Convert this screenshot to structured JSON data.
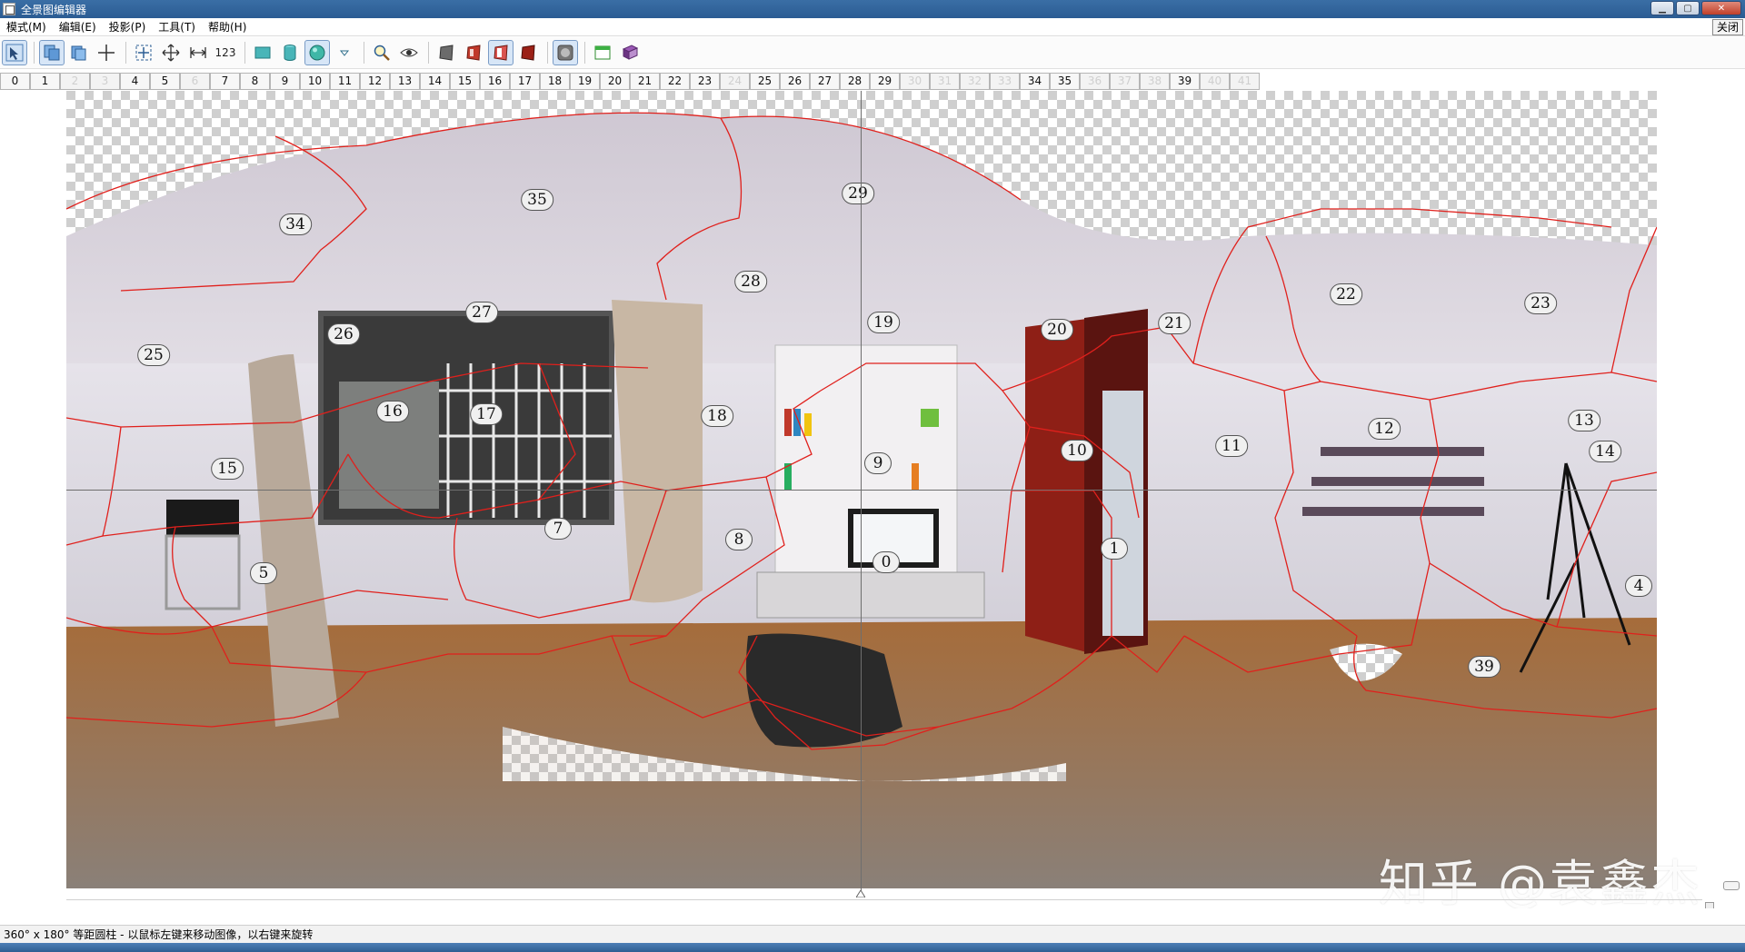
{
  "window": {
    "title": "全景图编辑器"
  },
  "menu": {
    "items": [
      "模式(M)",
      "编辑(E)",
      "投影(P)",
      "工具(T)",
      "帮助(H)"
    ],
    "close_panel": "关闭"
  },
  "toolbar": {
    "numbering_label": "123",
    "tools": [
      "select-tool-icon",
      "pages-icon",
      "pages-stack-icon",
      "crosshair-icon",
      "fit-icon",
      "move-icon",
      "straighten-icon",
      "rectilinear-icon",
      "cylinder-icon",
      "sphere-icon",
      "dropdown-icon",
      "zoom-icon",
      "preview-eye-icon",
      "layer-dark-icon",
      "layer-red-icon",
      "layer-red-selected-icon",
      "layer-red-dark-icon",
      "badge-3-icon",
      "window-green-icon",
      "book-icon"
    ],
    "badge_value": "3"
  },
  "image_tabs": [
    {
      "label": "0",
      "enabled": true
    },
    {
      "label": "1",
      "enabled": true
    },
    {
      "label": "2",
      "enabled": false
    },
    {
      "label": "3",
      "enabled": false
    },
    {
      "label": "4",
      "enabled": true
    },
    {
      "label": "5",
      "enabled": true
    },
    {
      "label": "6",
      "enabled": false
    },
    {
      "label": "7",
      "enabled": true
    },
    {
      "label": "8",
      "enabled": true
    },
    {
      "label": "9",
      "enabled": true
    },
    {
      "label": "10",
      "enabled": true
    },
    {
      "label": "11",
      "enabled": true
    },
    {
      "label": "12",
      "enabled": true
    },
    {
      "label": "13",
      "enabled": true
    },
    {
      "label": "14",
      "enabled": true
    },
    {
      "label": "15",
      "enabled": true
    },
    {
      "label": "16",
      "enabled": true
    },
    {
      "label": "17",
      "enabled": true
    },
    {
      "label": "18",
      "enabled": true
    },
    {
      "label": "19",
      "enabled": true
    },
    {
      "label": "20",
      "enabled": true
    },
    {
      "label": "21",
      "enabled": true
    },
    {
      "label": "22",
      "enabled": true
    },
    {
      "label": "23",
      "enabled": true
    },
    {
      "label": "24",
      "enabled": false
    },
    {
      "label": "25",
      "enabled": true
    },
    {
      "label": "26",
      "enabled": true
    },
    {
      "label": "27",
      "enabled": true
    },
    {
      "label": "28",
      "enabled": true
    },
    {
      "label": "29",
      "enabled": true
    },
    {
      "label": "30",
      "enabled": false
    },
    {
      "label": "31",
      "enabled": false
    },
    {
      "label": "32",
      "enabled": false
    },
    {
      "label": "33",
      "enabled": false
    },
    {
      "label": "34",
      "enabled": true
    },
    {
      "label": "35",
      "enabled": true
    },
    {
      "label": "36",
      "enabled": false
    },
    {
      "label": "37",
      "enabled": false
    },
    {
      "label": "38",
      "enabled": false
    },
    {
      "label": "39",
      "enabled": true
    },
    {
      "label": "40",
      "enabled": false
    },
    {
      "label": "41",
      "enabled": false
    }
  ],
  "regions": [
    "0",
    "1",
    "4",
    "5",
    "7",
    "8",
    "9",
    "10",
    "11",
    "12",
    "13",
    "14",
    "15",
    "16",
    "17",
    "18",
    "19",
    "20",
    "21",
    "22",
    "23",
    "25",
    "26",
    "27",
    "28",
    "29",
    "34",
    "35",
    "39"
  ],
  "watermark": "知乎 @袁鑫杰",
  "status": {
    "text": "360° x 180° 等距圆柱 - 以鼠标左键来移动图像，以右键来旋转"
  },
  "colors": {
    "seam": "#e0201c",
    "title_bar": "#3a6ea5",
    "floor": "#a9713f",
    "wall": "#d9d6de",
    "door": "#8e1f16"
  }
}
